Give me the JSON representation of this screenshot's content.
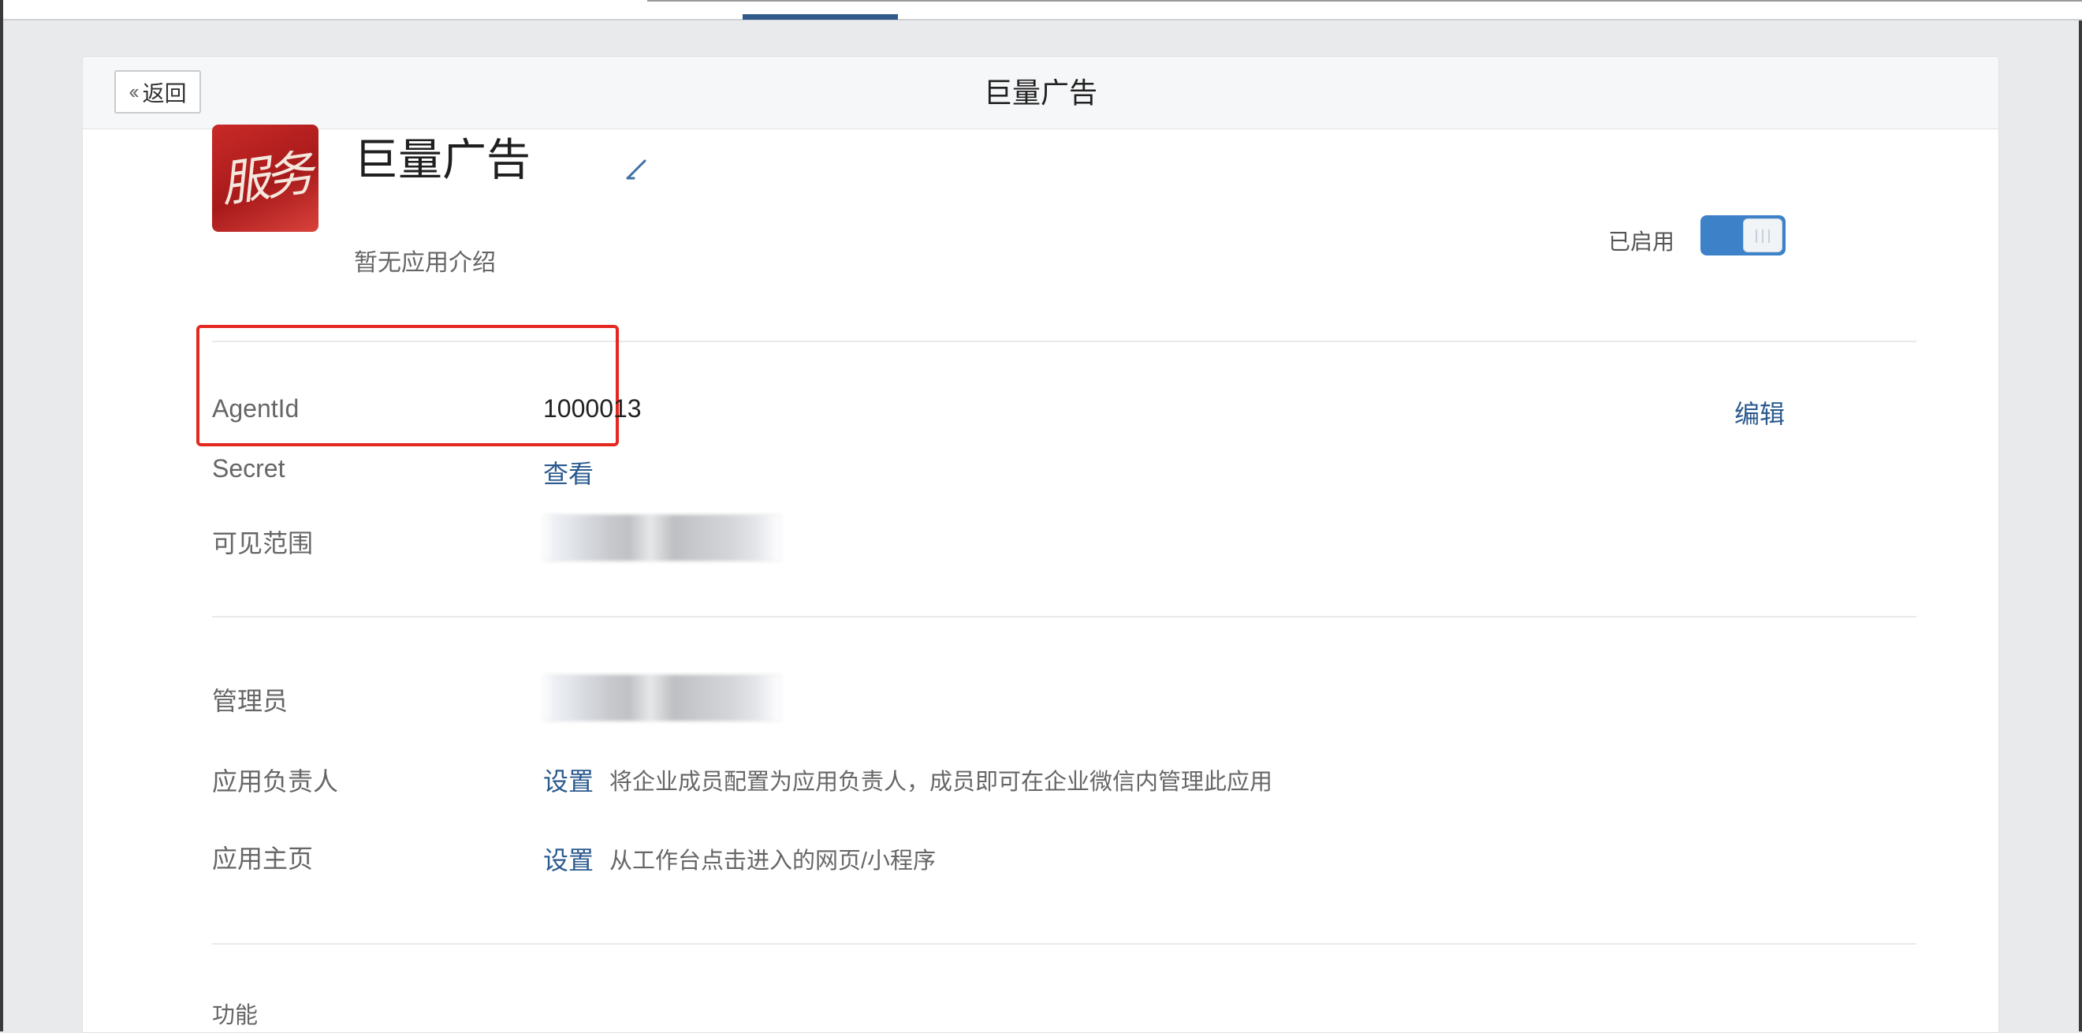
{
  "header": {
    "back_label": "返回",
    "title": "巨量广告"
  },
  "app": {
    "name": "巨量广告",
    "description": "暂无应用介绍",
    "status_label": "已启用",
    "enabled": true
  },
  "details": {
    "edit_label": "编辑",
    "agentid_label": "AgentId",
    "agentid_value": "1000013",
    "secret_label": "Secret",
    "secret_action": "查看",
    "visibility_label": "可见范围"
  },
  "management": {
    "admin_label": "管理员",
    "owner_label": "应用负责人",
    "owner_action": "设置",
    "owner_desc": "将企业成员配置为应用负责人，成员即可在企业微信内管理此应用",
    "homepage_label": "应用主页",
    "homepage_action": "设置",
    "homepage_desc": "从工作台点击进入的网页/小程序"
  },
  "features": {
    "label": "功能"
  }
}
